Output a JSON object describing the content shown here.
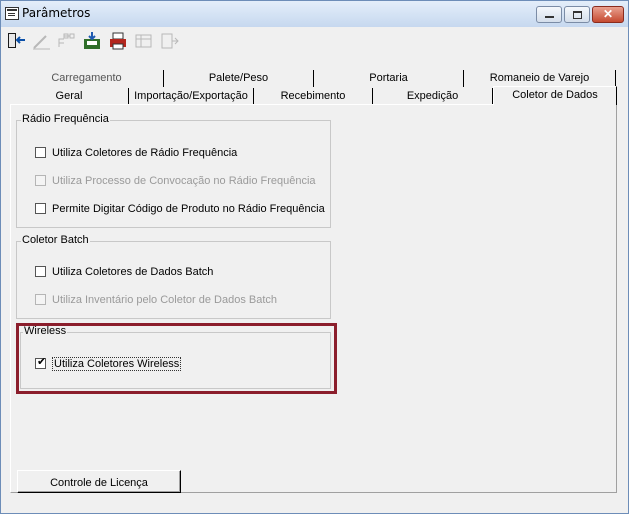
{
  "window": {
    "title": "Parâmetros"
  },
  "tabs_row1": [
    "Carregamento",
    "Palete/Peso",
    "Portaria",
    "Romaneio de Varejo"
  ],
  "tabs_row2": [
    "Geral",
    "Importação/Exportação",
    "Recebimento",
    "Expedição",
    "Coletor de Dados"
  ],
  "active_tab": "Coletor de Dados",
  "radio_frequencia": {
    "title": "Rádio Frequência",
    "options": [
      {
        "label": "Utiliza Coletores de Rádio Frequência",
        "checked": false,
        "enabled": true
      },
      {
        "label": "Utiliza Processo de Convocação no Rádio Frequência",
        "checked": false,
        "enabled": false
      },
      {
        "label": "Permite Digitar Código de Produto no Rádio Frequência",
        "checked": false,
        "enabled": true
      }
    ]
  },
  "coletor_batch": {
    "title": "Coletor Batch",
    "options": [
      {
        "label": "Utiliza Coletores de Dados Batch",
        "checked": false,
        "enabled": true
      },
      {
        "label": "Utiliza Inventário pelo Coletor de Dados Batch",
        "checked": false,
        "enabled": false
      }
    ]
  },
  "wireless": {
    "title": "Wireless",
    "options": [
      {
        "label": "Utiliza Coletores Wireless",
        "checked": true,
        "enabled": true
      }
    ]
  },
  "buttons": {
    "license": "Controle de Licença",
    "close_glyph": "✕"
  },
  "colors": {
    "highlight": "#8b1e2c",
    "window_bg": "#f0f0f0",
    "disabled_text": "#9a9a9a"
  }
}
